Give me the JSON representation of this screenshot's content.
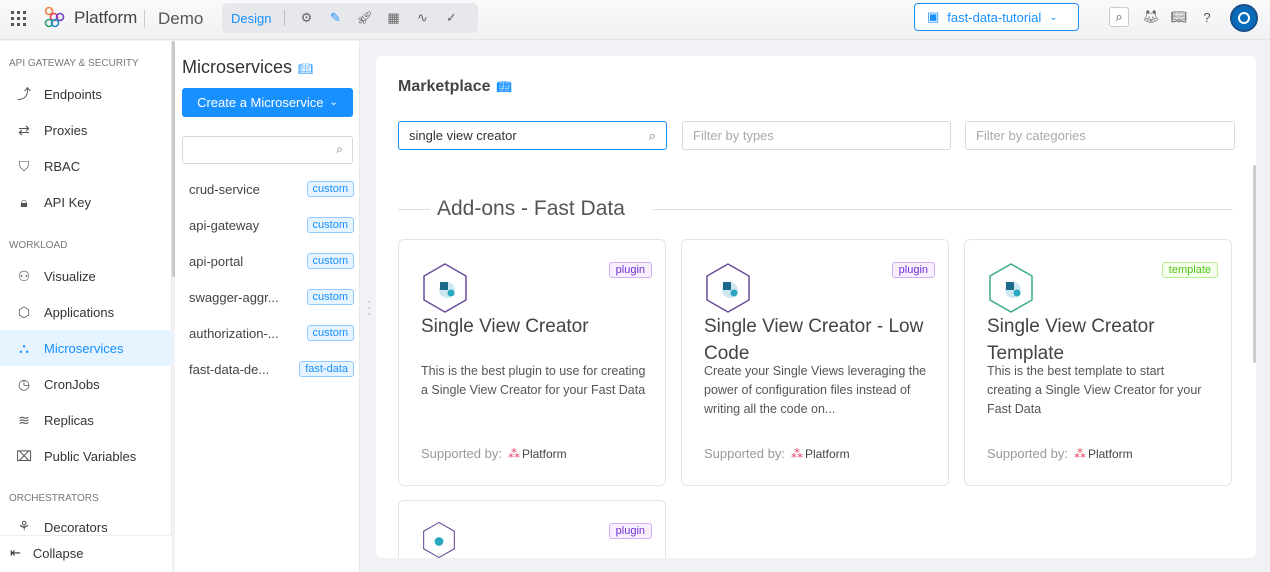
{
  "topbar": {
    "logo_small": "mia",
    "logo": "Platform",
    "project_name": "Demo",
    "mode_active": "Design",
    "environment": "fast-data-tutorial"
  },
  "sidebar": {
    "sections": [
      {
        "title": "API GATEWAY & SECURITY"
      },
      {
        "title": "WORKLOAD"
      },
      {
        "title": "ORCHESTRATORS"
      }
    ],
    "items": [
      {
        "label": "Endpoints",
        "icon": "endpoints-icon"
      },
      {
        "label": "Proxies",
        "icon": "proxies-icon"
      },
      {
        "label": "RBAC",
        "icon": "shield-icon"
      },
      {
        "label": "API Key",
        "icon": "lock-icon"
      },
      {
        "label": "Visualize",
        "icon": "visualize-icon"
      },
      {
        "label": "Applications",
        "icon": "box-icon"
      },
      {
        "label": "Microservices",
        "icon": "microservices-icon"
      },
      {
        "label": "CronJobs",
        "icon": "clock-icon"
      },
      {
        "label": "Replicas",
        "icon": "layers-icon"
      },
      {
        "label": "Public Variables",
        "icon": "variables-icon"
      },
      {
        "label": "Decorators",
        "icon": "decorators-icon"
      }
    ],
    "collapse": "Collapse"
  },
  "panel": {
    "title": "Microservices",
    "create_label": "Create a Microservice",
    "search_placeholder": "",
    "services": [
      {
        "name": "crud-service",
        "tag": "custom"
      },
      {
        "name": "api-gateway",
        "tag": "custom"
      },
      {
        "name": "api-portal",
        "tag": "custom"
      },
      {
        "name": "swagger-aggr...",
        "tag": "custom"
      },
      {
        "name": "authorization-...",
        "tag": "custom"
      },
      {
        "name": "fast-data-de...",
        "tag": "fast-data"
      }
    ]
  },
  "marketplace": {
    "title": "Marketplace",
    "search_value": "single view creator",
    "types_placeholder": "Filter by types",
    "categories_placeholder": "Filter by categories",
    "section": "Add-ons - Fast Data",
    "supported_label": "Supported by:",
    "cards": [
      {
        "name": "Single View Creator",
        "tag": "plugin",
        "description": "This is the best plugin to use for creating a Single View Creator for your Fast Data"
      },
      {
        "name": "Single View Creator - Low Code",
        "tag": "plugin",
        "description": "Create your Single Views leveraging the power of configuration files instead of writing all the code on..."
      },
      {
        "name": "Single View Creator Template",
        "tag": "template",
        "description": "This is the best template to start creating a Single View Creator for your Fast Data"
      },
      {
        "name": "",
        "tag": "plugin",
        "description": ""
      }
    ]
  }
}
